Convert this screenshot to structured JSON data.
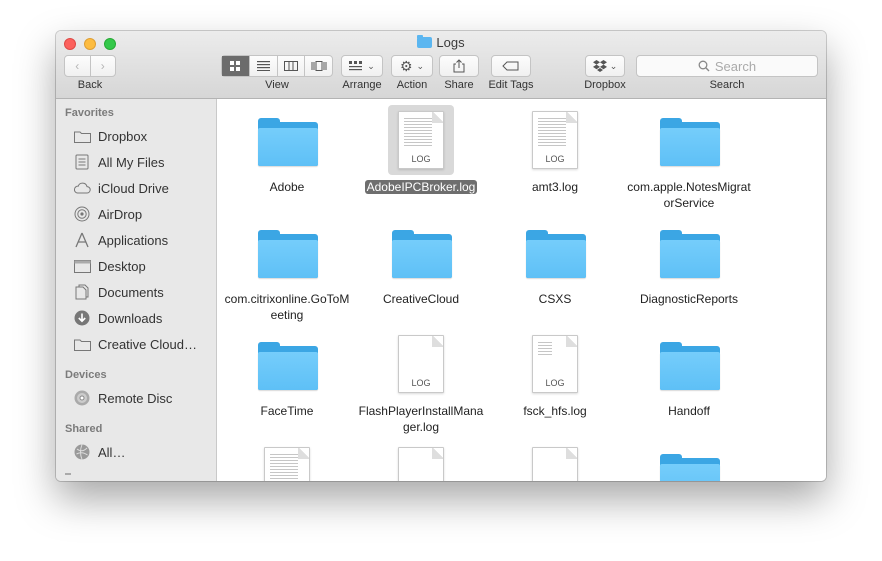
{
  "window": {
    "title": "Logs",
    "title_icon": "folder-icon"
  },
  "toolbar": {
    "back_label": "Back",
    "view_label": "View",
    "arrange_label": "Arrange",
    "action_label": "Action",
    "share_label": "Share",
    "edit_tags_label": "Edit Tags",
    "dropbox_label": "Dropbox",
    "search_label": "Search",
    "search_placeholder": "Search",
    "active_view": "icon"
  },
  "sidebar": {
    "favorites_heading": "Favorites",
    "favorites": [
      {
        "label": "Dropbox",
        "icon": "folder-icon"
      },
      {
        "label": "All My Files",
        "icon": "all-files-icon"
      },
      {
        "label": "iCloud Drive",
        "icon": "cloud-icon"
      },
      {
        "label": "AirDrop",
        "icon": "airdrop-icon"
      },
      {
        "label": "Applications",
        "icon": "applications-icon"
      },
      {
        "label": "Desktop",
        "icon": "desktop-icon"
      },
      {
        "label": "Documents",
        "icon": "documents-icon"
      },
      {
        "label": "Downloads",
        "icon": "downloads-icon"
      },
      {
        "label": "Creative Cloud…",
        "icon": "folder-icon"
      }
    ],
    "devices_heading": "Devices",
    "devices": [
      {
        "label": "Remote Disc",
        "icon": "disc-icon"
      }
    ],
    "shared_heading": "Shared",
    "shared": [
      {
        "label": "All…",
        "icon": "network-icon"
      }
    ]
  },
  "files": [
    {
      "name": "Adobe",
      "type": "folder"
    },
    {
      "name": "AdobeIPCBroker.log",
      "type": "log",
      "ext": "LOG",
      "selected": true
    },
    {
      "name": "amt3.log",
      "type": "log",
      "ext": "LOG"
    },
    {
      "name": "com.apple.NotesMigratorService",
      "type": "folder"
    },
    {
      "name": "com.citrixonline.GoToMeeting",
      "type": "folder"
    },
    {
      "name": "CreativeCloud",
      "type": "folder"
    },
    {
      "name": "CSXS",
      "type": "folder"
    },
    {
      "name": "DiagnosticReports",
      "type": "folder"
    },
    {
      "name": "FaceTime",
      "type": "folder"
    },
    {
      "name": "FlashPlayerInstallManager.log",
      "type": "log",
      "ext": "LOG"
    },
    {
      "name": "fsck_hfs.log",
      "type": "log",
      "ext": "LOG"
    },
    {
      "name": "Handoff",
      "type": "folder"
    }
  ],
  "colors": {
    "folder": "#5ec0f6",
    "selection": "#6e6e6e",
    "sidebar": "#e8e8e8"
  }
}
